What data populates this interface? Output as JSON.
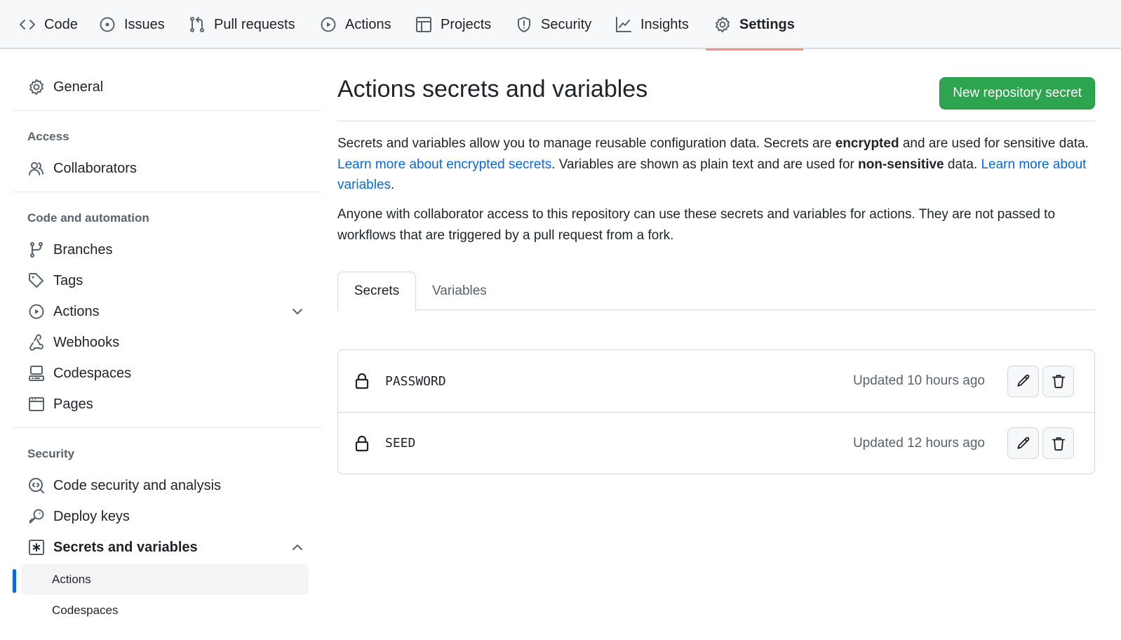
{
  "topnav": {
    "tabs": [
      {
        "label": "Code",
        "icon": "code-icon"
      },
      {
        "label": "Issues",
        "icon": "issue-icon"
      },
      {
        "label": "Pull requests",
        "icon": "pull-request-icon"
      },
      {
        "label": "Actions",
        "icon": "play-icon"
      },
      {
        "label": "Projects",
        "icon": "table-icon"
      },
      {
        "label": "Security",
        "icon": "shield-icon"
      },
      {
        "label": "Insights",
        "icon": "graph-icon"
      },
      {
        "label": "Settings",
        "icon": "gear-icon",
        "active": true
      }
    ]
  },
  "sidebar": {
    "general": "General",
    "sections": {
      "access": "Access",
      "code_automation": "Code and automation",
      "security": "Security"
    },
    "items": {
      "collaborators": "Collaborators",
      "branches": "Branches",
      "tags": "Tags",
      "actions": "Actions",
      "webhooks": "Webhooks",
      "codespaces": "Codespaces",
      "pages": "Pages",
      "code_security": "Code security and analysis",
      "deploy_keys": "Deploy keys",
      "secrets_variables": "Secrets and variables"
    },
    "sub_items": {
      "actions": "Actions",
      "codespaces": "Codespaces"
    }
  },
  "main": {
    "title": "Actions secrets and variables",
    "new_button": "New repository secret",
    "desc1": {
      "p1": "Secrets and variables allow you to manage reusable configuration data. Secrets are ",
      "b1": "encrypted",
      "p2": " and are used for sensitive data. ",
      "link1": "Learn more about encrypted secrets",
      "p3": ". Variables are shown as plain text and are used for ",
      "b2": "non-sensitive",
      "p4": " data. ",
      "link2": "Learn more about variables",
      "p5": "."
    },
    "desc2": "Anyone with collaborator access to this repository can use these secrets and variables for actions. They are not passed to workflows that are triggered by a pull request from a fork.",
    "tabs": {
      "secrets": "Secrets",
      "variables": "Variables"
    },
    "secrets": [
      {
        "name": "PASSWORD",
        "updated": "Updated 10 hours ago"
      },
      {
        "name": "SEED",
        "updated": "Updated 12 hours ago"
      }
    ]
  },
  "colors": {
    "accent": "#0969da",
    "primary_button": "#2da44e",
    "active_tab_underline": "#fd8c73"
  }
}
